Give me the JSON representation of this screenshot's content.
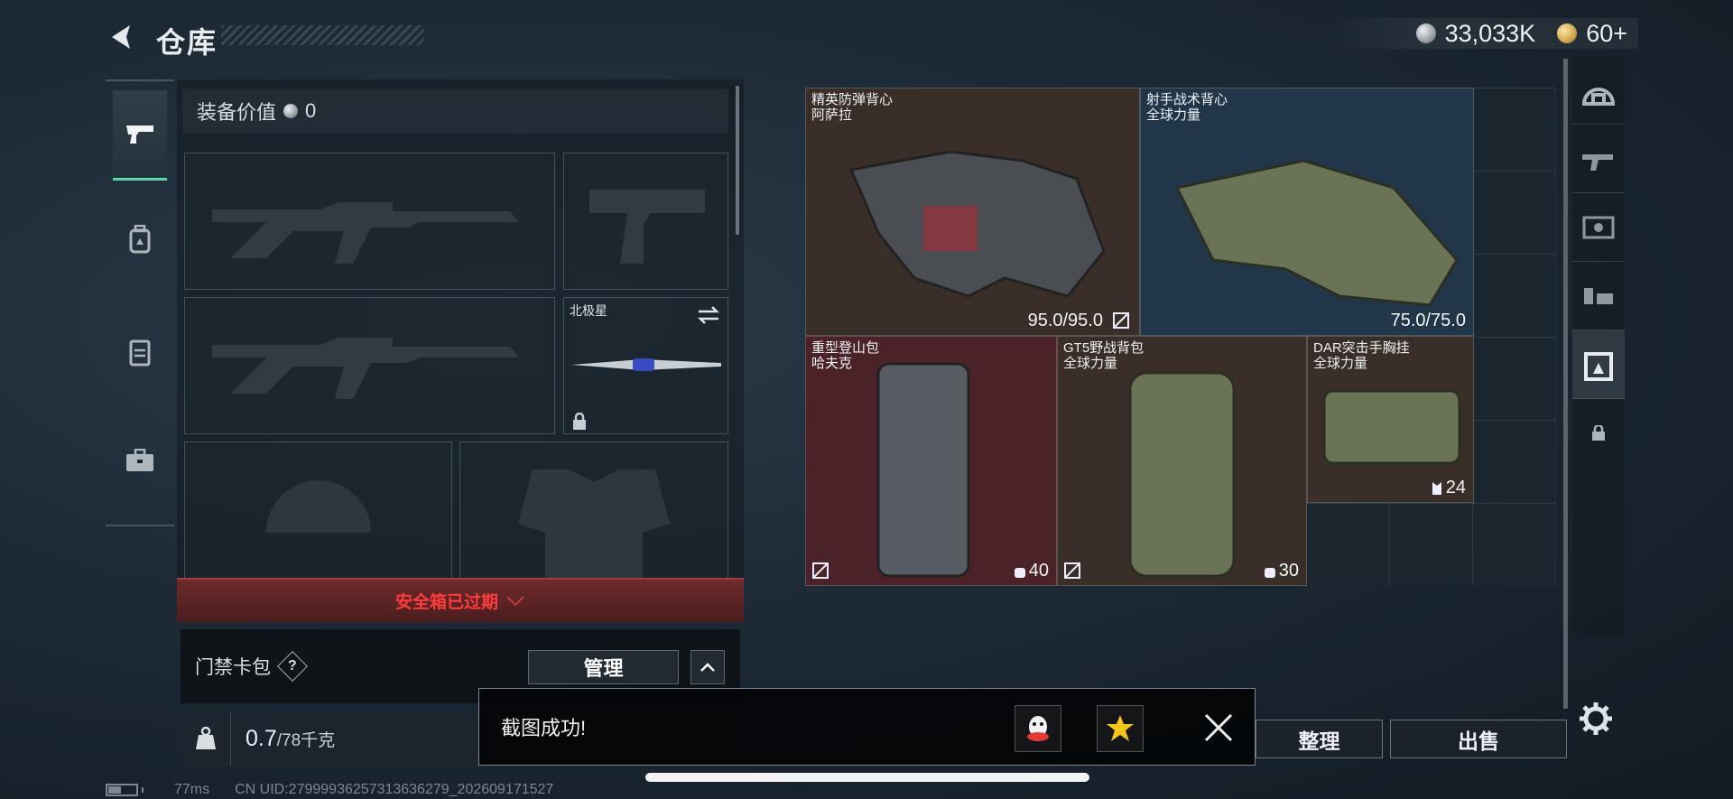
{
  "header": {
    "title": "仓库",
    "currency_silver": "33,033K",
    "currency_gold": "60+"
  },
  "loadout": {
    "equipment_value_label": "装备价值",
    "equipment_value": "0",
    "melee_name": "北极星",
    "safe_box_status": "安全箱已过期",
    "keycard_label": "门禁卡包",
    "help_label": "?",
    "manage_button": "管理",
    "weight_value": "0.7",
    "weight_capacity": "/78千克"
  },
  "stash": {
    "items": [
      {
        "name": "精英防弹背心",
        "brand": "阿萨拉",
        "durability": "95.0/95.0",
        "color": "#3a2f28"
      },
      {
        "name": "射手战术背心",
        "brand": "全球力量",
        "durability": "75.0/75.0",
        "color": "#22364a"
      },
      {
        "name": "重型登山包",
        "brand": "哈夫克",
        "capacity": "40",
        "color": "#4a2228"
      },
      {
        "name": "GT5野战背包",
        "brand": "全球力量",
        "capacity": "30",
        "color": "#3a2f28"
      },
      {
        "name": "DAR突击手胸挂",
        "brand": "全球力量",
        "capacity": "24",
        "color": "#3a2f28"
      }
    ]
  },
  "bottom": {
    "sort_button": "整理",
    "sell_button": "出售"
  },
  "toast": {
    "message": "截图成功!"
  },
  "status": {
    "ping": "77ms",
    "uid": "CN UID:2799993625731363627​9_202609171527"
  },
  "icons": [
    "back-icon",
    "pistol-icon",
    "backpack-icon",
    "vest-icon",
    "briefcase-icon",
    "helmet-icon",
    "armor-icon",
    "lock-icon",
    "swap-icon",
    "weight-icon",
    "chevron-up-icon",
    "qq-icon",
    "qzone-icon",
    "close-icon",
    "gear-icon"
  ]
}
